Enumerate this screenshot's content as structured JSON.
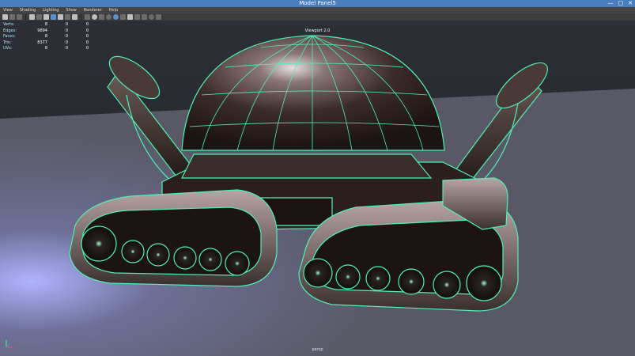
{
  "window": {
    "title": "Model Panel5",
    "controls": [
      "—",
      "□",
      "✕"
    ]
  },
  "menu": [
    "View",
    "Shading",
    "Lighting",
    "Show",
    "Renderer",
    "Help"
  ],
  "hud": {
    "rows": [
      {
        "label": "Verts:",
        "values": [
          "8",
          "0",
          "0"
        ]
      },
      {
        "label": "Edges:",
        "values": [
          "9894",
          "0",
          "0"
        ]
      },
      {
        "label": "Faces:",
        "values": [
          "8",
          "0",
          "0"
        ]
      },
      {
        "label": "Tris:",
        "values": [
          "8377",
          "0",
          "0"
        ]
      },
      {
        "label": "UVs:",
        "values": [
          "8",
          "0",
          "0"
        ]
      }
    ]
  },
  "viewport": {
    "renderer_label": "Viewport 2.0",
    "camera": "persp"
  },
  "colors": {
    "wire": "#4ff0b8",
    "title_bar": "#4a7fbf",
    "menu_bg": "#444444",
    "toolbar_bg": "#3c3c3c",
    "floor": "#595965"
  },
  "icons": [
    "select-icon",
    "lasso-icon",
    "paint-icon",
    "camera-icon",
    "grid-icon",
    "wireframe-icon",
    "smooth-shade-icon",
    "texture-icon",
    "light-icon",
    "shadow-icon",
    "isolate-icon",
    "xray-icon",
    "resolution-gate-icon"
  ]
}
